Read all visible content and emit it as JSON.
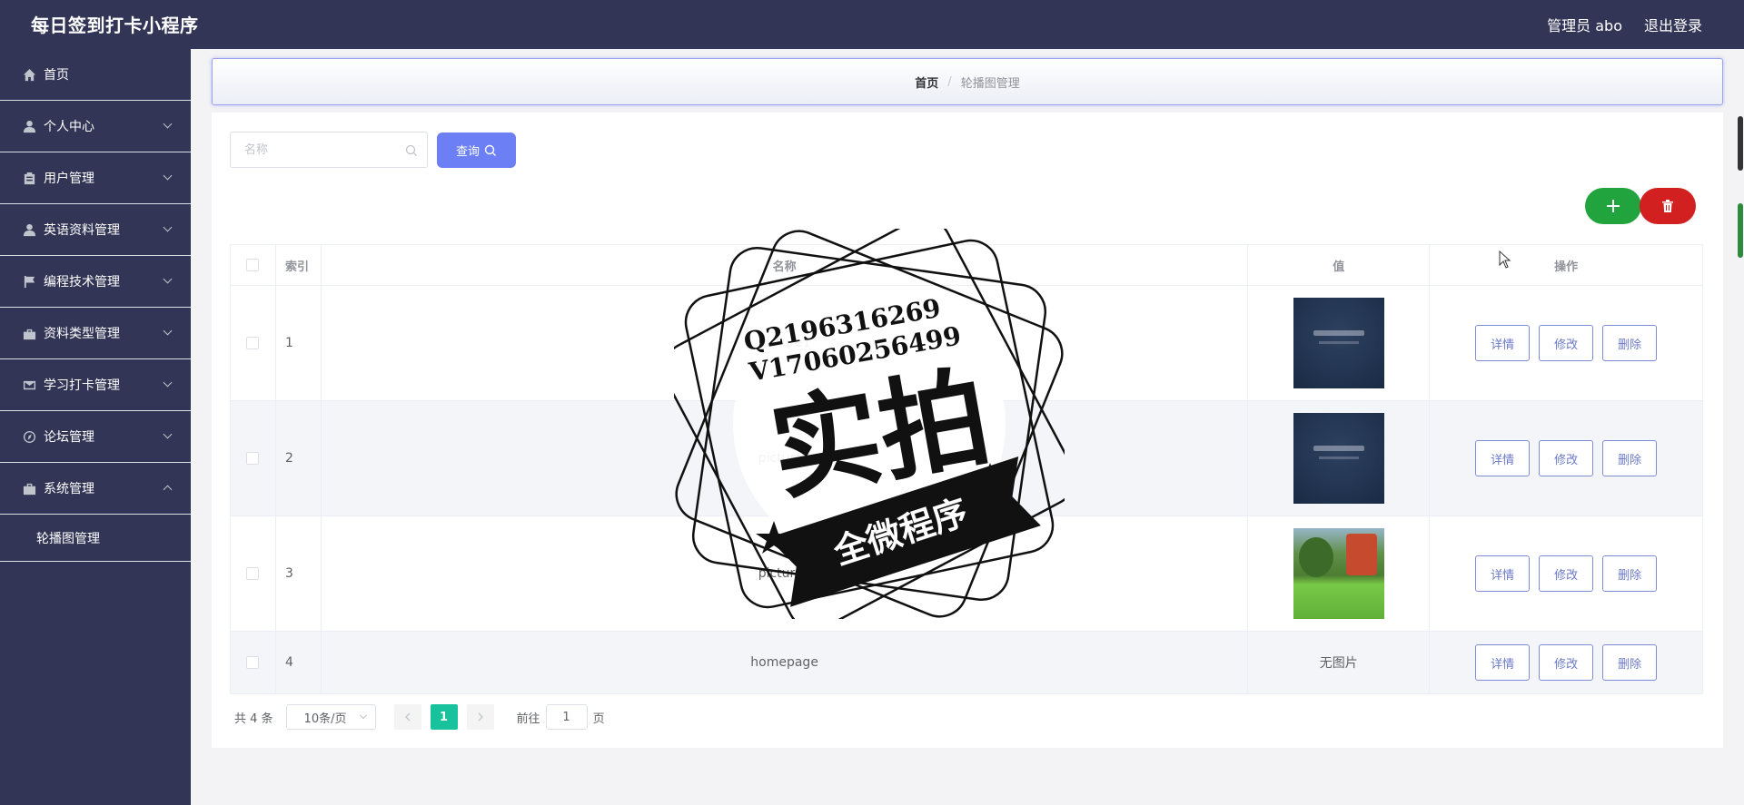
{
  "app": {
    "title": "每日签到打卡小程序",
    "admin": "管理员 abo",
    "logout": "退出登录"
  },
  "sidebar": {
    "items": [
      {
        "label": "首页",
        "icon": "home-icon"
      },
      {
        "label": "个人中心",
        "icon": "user-icon"
      },
      {
        "label": "用户管理",
        "icon": "clipboard-icon"
      },
      {
        "label": "英语资料管理",
        "icon": "user-icon"
      },
      {
        "label": "编程技术管理",
        "icon": "flag-icon"
      },
      {
        "label": "资料类型管理",
        "icon": "briefcase-icon"
      },
      {
        "label": "学习打卡管理",
        "icon": "mail-icon"
      },
      {
        "label": "论坛管理",
        "icon": "compass-icon"
      },
      {
        "label": "系统管理",
        "icon": "toolbox-icon"
      }
    ],
    "sub_items": [
      {
        "label": "轮播图管理"
      }
    ]
  },
  "breadcrumb": {
    "home": "首页",
    "separator": "/",
    "current": "轮播图管理"
  },
  "search": {
    "placeholder": "名称",
    "value": "",
    "query_label": "查询"
  },
  "table": {
    "headers": {
      "index": "索引",
      "name": "名称",
      "value": "值",
      "actions": "操作"
    },
    "rows": [
      {
        "index": "1",
        "name": "picture1",
        "value_image": "dark-banner-thumbnail"
      },
      {
        "index": "2",
        "name": "picture2",
        "value_image": "dark-banner-thumbnail"
      },
      {
        "index": "3",
        "name": "picture3",
        "value_image": "park-photo-thumbnail"
      },
      {
        "index": "4",
        "name": "homepage",
        "value_text": "无图片"
      }
    ],
    "action_labels": {
      "detail": "详情",
      "edit": "修改",
      "delete": "删除"
    }
  },
  "pagination": {
    "total": "共 4 条",
    "page_size": "10条/页",
    "current_page": "1",
    "goto_label": "前往",
    "goto_value": "1",
    "page_suffix": "页"
  },
  "watermark": {
    "line1": "Q2196316269",
    "line2": "V17060256499",
    "main": "实拍",
    "banner": "全微程序"
  },
  "colors": {
    "sidebar_bg": "#323555",
    "primary": "#6c7ff5",
    "add": "#21a43e",
    "delete": "#d1201f",
    "page_active": "#17c29c"
  }
}
